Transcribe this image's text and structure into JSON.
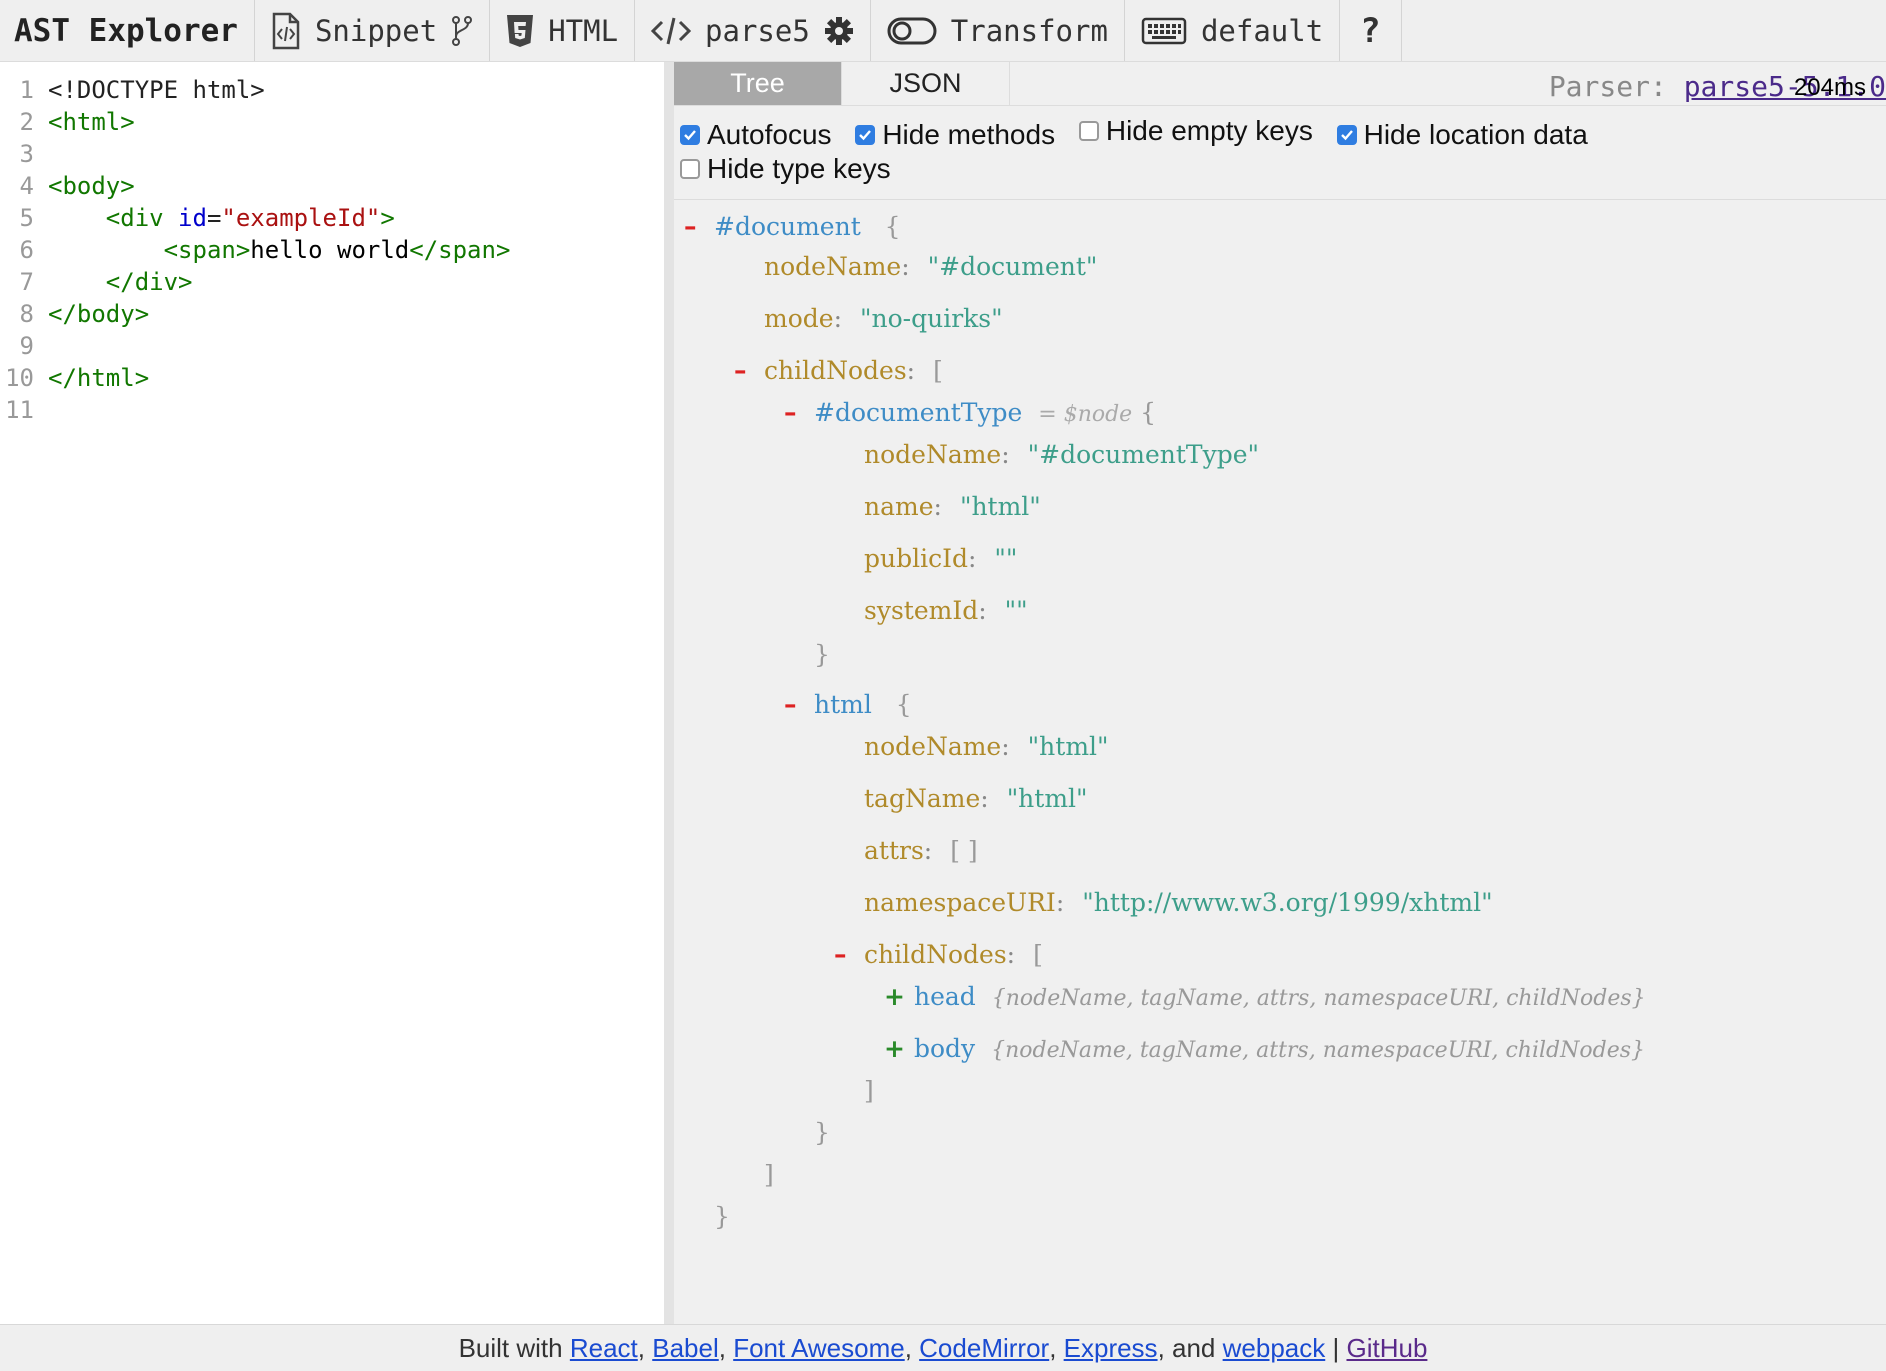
{
  "toolbar": {
    "title": "AST Explorer",
    "snippet_label": "Snippet",
    "language_label": "HTML",
    "parser_label": "parse5",
    "transform_label": "Transform",
    "keymap_label": "default",
    "help_label": "?"
  },
  "editor": {
    "lines": [
      {
        "n": "1"
      },
      {
        "n": "2"
      },
      {
        "n": "3"
      },
      {
        "n": "4"
      },
      {
        "n": "5"
      },
      {
        "n": "6"
      },
      {
        "n": "7"
      },
      {
        "n": "8"
      },
      {
        "n": "9"
      },
      {
        "n": "10"
      },
      {
        "n": "11"
      }
    ],
    "doctype": "<!DOCTYPE html>",
    "html_open": "<html>",
    "body_open": "<body>",
    "div_tag_start": "<div",
    "div_attr": "id",
    "div_eq": "=",
    "div_attr_value": "\"exampleId\"",
    "div_tag_end": ">",
    "span_open": "<span>",
    "span_text": "hello world",
    "span_close": "</span>",
    "div_close": "</div>",
    "body_close": "</body>",
    "html_close": "</html>"
  },
  "output": {
    "tabs": [
      "Tree",
      "JSON"
    ],
    "parser_prefix": "Parser:",
    "parser_link": "parse5-5.1.0",
    "parse_time": "204ms",
    "options": [
      {
        "label": "Autofocus",
        "checked": true
      },
      {
        "label": "Hide methods",
        "checked": true
      },
      {
        "label": "Hide empty keys",
        "checked": false
      },
      {
        "label": "Hide location data",
        "checked": true
      },
      {
        "label": "Hide type keys",
        "checked": false
      }
    ]
  },
  "tree": {
    "document_node": "#document",
    "open_brace": "{",
    "close_brace": "}",
    "open_bracket": "[",
    "close_bracket": "]",
    "empty_array": "[ ]",
    "collapse_symbol": "–",
    "expand_symbol": "+",
    "colon": ":",
    "doc_nodeName_key": "nodeName",
    "doc_nodeName_val": "\"#document\"",
    "doc_mode_key": "mode",
    "doc_mode_val": "\"no-quirks\"",
    "doc_childNodes_key": "childNodes",
    "doctype_node": "#documentType",
    "doctype_meta": "= $node",
    "dt_nodeName_key": "nodeName",
    "dt_nodeName_val": "\"#documentType\"",
    "dt_name_key": "name",
    "dt_name_val": "\"html\"",
    "dt_publicId_key": "publicId",
    "dt_publicId_val": "\"\"",
    "dt_systemId_key": "systemId",
    "dt_systemId_val": "\"\"",
    "html_node": "html",
    "h_nodeName_key": "nodeName",
    "h_nodeName_val": "\"html\"",
    "h_tagName_key": "tagName",
    "h_tagName_val": "\"html\"",
    "h_attrs_key": "attrs",
    "h_ns_key": "namespaceURI",
    "h_ns_val": "\"http://www.w3.org/1999/xhtml\"",
    "h_childNodes_key": "childNodes",
    "head_node": "head",
    "head_summary": "{nodeName, tagName, attrs, namespaceURI, childNodes}",
    "body_node": "body",
    "body_summary": "{nodeName, tagName, attrs, namespaceURI, childNodes}"
  },
  "footer": {
    "prefix": "Built with",
    "links": [
      "React",
      "Babel",
      "Font Awesome",
      "CodeMirror",
      "Express"
    ],
    "and": ", and",
    "webpack": "webpack",
    "sep": "|",
    "github": "GitHub"
  }
}
